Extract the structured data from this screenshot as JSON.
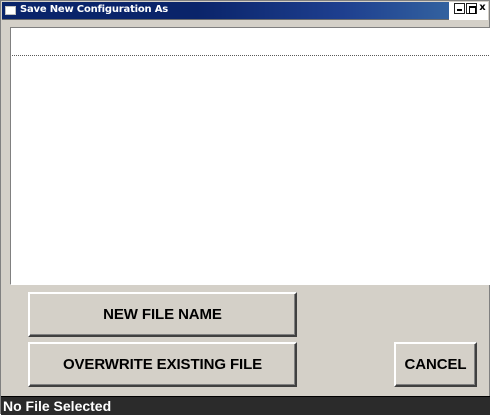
{
  "window": {
    "title": "Save New Configuration As",
    "controls": {
      "close_glyph": "x"
    }
  },
  "file_list": {
    "items": []
  },
  "buttons": {
    "new_file_name": "NEW FILE NAME",
    "overwrite_existing_file": "OVERWRITE EXISTING FILE",
    "cancel": "CANCEL"
  },
  "status": {
    "text": "No File Selected"
  },
  "colors": {
    "title_bar": "#0a246a",
    "dialog_face": "#d4d0c8",
    "status_bar": "#2b2b2b",
    "status_text": "#ffffff"
  }
}
